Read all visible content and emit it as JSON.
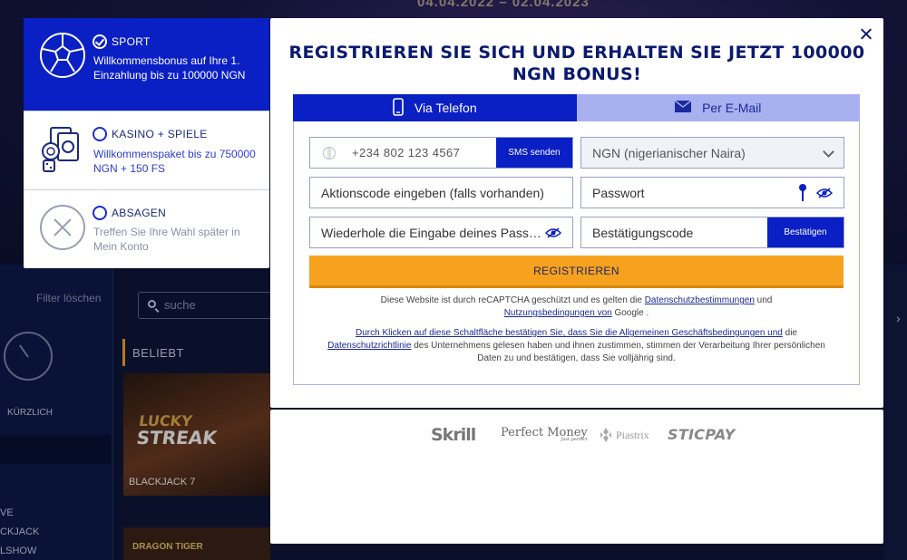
{
  "background": {
    "date_range": "04.04.2022 – 02.04.2023",
    "filter_clear": "Filter löschen",
    "recent_label": "KÜRZLICH",
    "side_menu": [
      "VE",
      "CKJACK",
      "LSHOW"
    ],
    "search_placeholder": "suche",
    "popular_heading": "BELIEBT",
    "tile_logo_line1": "LUCKY",
    "tile_logo_line2": "STREAK",
    "tile_name": "BLACKJACK 7",
    "tile2_name": "DRAGON TIGER"
  },
  "bonus_panel": {
    "options": [
      {
        "title": "SPORT",
        "description": "Willkommensbonus auf Ihre 1. Einzahlung bis zu 100000 NGN",
        "selected": true,
        "icon": "soccer-ball-icon"
      },
      {
        "title": "KASINO + SPIELE",
        "description": "Willkommenspaket bis zu 750000 NGN + 150 FS",
        "selected": false,
        "icon": "casino-cards-icon"
      },
      {
        "title": "ABSAGEN",
        "description": "Treffen Sie Ihre Wahl später in Mein Konto",
        "selected": false,
        "icon": "cancel-x-icon"
      }
    ]
  },
  "modal": {
    "title": "REGISTRIEREN SIE SICH UND ERHALTEN SIE JETZT 100000 NGN BONUS!",
    "tabs": [
      {
        "label": "Via Telefon",
        "active": true,
        "icon": "smartphone-icon"
      },
      {
        "label": "Per E-Mail",
        "active": false,
        "icon": "envelope-icon"
      }
    ],
    "form": {
      "phone_placeholder": "+234 802 123 4567",
      "sms_button": "SMS senden",
      "currency_value": "NGN (nigerianischer Naira)",
      "promo_placeholder": "Aktionscode eingeben (falls vorhanden)",
      "password_placeholder": "Passwort",
      "repeat_password_placeholder": "Wiederhole die Eingabe deines Passworts",
      "confirmation_code_placeholder": "Bestätigungscode",
      "confirm_button": "Bestätigen",
      "register_button": "REGISTRIEREN"
    },
    "legal": {
      "recaptcha_prefix": "Diese Website ist durch reCAPTCHA geschützt und es gelten die",
      "privacy_link": "Datenschutzbestimmungen",
      "and": "und",
      "terms_link": "Nutzungsbedingungen von",
      "recaptcha_suffix": "Google .",
      "consent_link1": "Durch Klicken auf diese Schaltfläche bestätigen Sie, dass Sie die Allgemeinen Geschäftsbedingungen und",
      "consent_mid": "die",
      "consent_link2": "Datenschutzrichtlinie",
      "consent_suffix": "des Unternehmens gelesen haben und ihnen zustimmen, stimmen der Verarbeitung Ihrer persönlichen Daten zu und bestätigen, dass Sie volljährig sind."
    }
  },
  "payments": {
    "logos": [
      "Skrill",
      "Perfect Money",
      "Piastrix",
      "STICPAY"
    ],
    "pm_tagline": "Just perfect"
  },
  "colors": {
    "primary_blue": "#0a1fc4",
    "light_blue": "#a9b0ef",
    "orange": "#f6a21e",
    "navy_text": "#0b1a6e"
  }
}
